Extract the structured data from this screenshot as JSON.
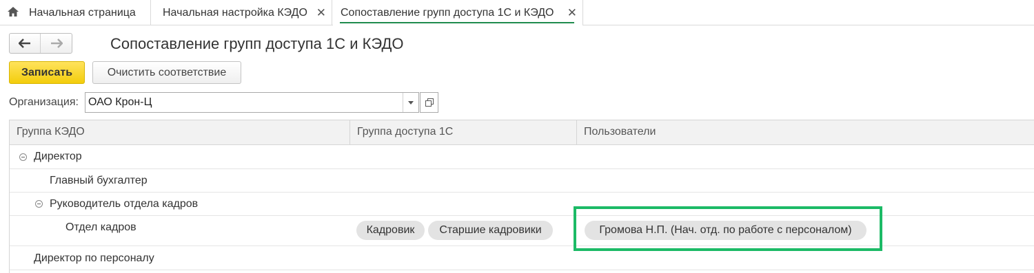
{
  "tabs": [
    {
      "label": "Начальная страница",
      "icon": "home-icon"
    },
    {
      "label": "Начальная настройка КЭДО",
      "close": "✕"
    },
    {
      "label": "Сопоставление групп доступа 1С и КЭДО",
      "close": "✕"
    }
  ],
  "nav": {
    "back": "🡐",
    "forward": "🡒"
  },
  "page_title": "Сопоставление групп доступа 1С и КЭДО",
  "toolbar": {
    "save_label": "Записать",
    "clear_label": "Очистить соответствие"
  },
  "organization": {
    "label": "Организация:",
    "value": "ОАО Крон-Ц"
  },
  "table": {
    "headers": [
      "Группа КЭДО",
      "Группа доступа 1С",
      "Пользователи"
    ],
    "rows": [
      {
        "name": "Директор"
      },
      {
        "name": "Главный бухгалтер"
      },
      {
        "name": "Руководитель отдела кадров"
      },
      {
        "name": "Отдел кадров",
        "groups": [
          "Кадровик",
          "Старшие кадровики"
        ],
        "users": [
          "Громова Н.П. (Нач. отд. по работе с персоналом)"
        ]
      },
      {
        "name": "Директор по персоналу"
      }
    ]
  },
  "colors": {
    "accent_save": "#f3cd0c",
    "highlight": "#1cba66",
    "active_tab_underline": "#1f8b4d"
  }
}
